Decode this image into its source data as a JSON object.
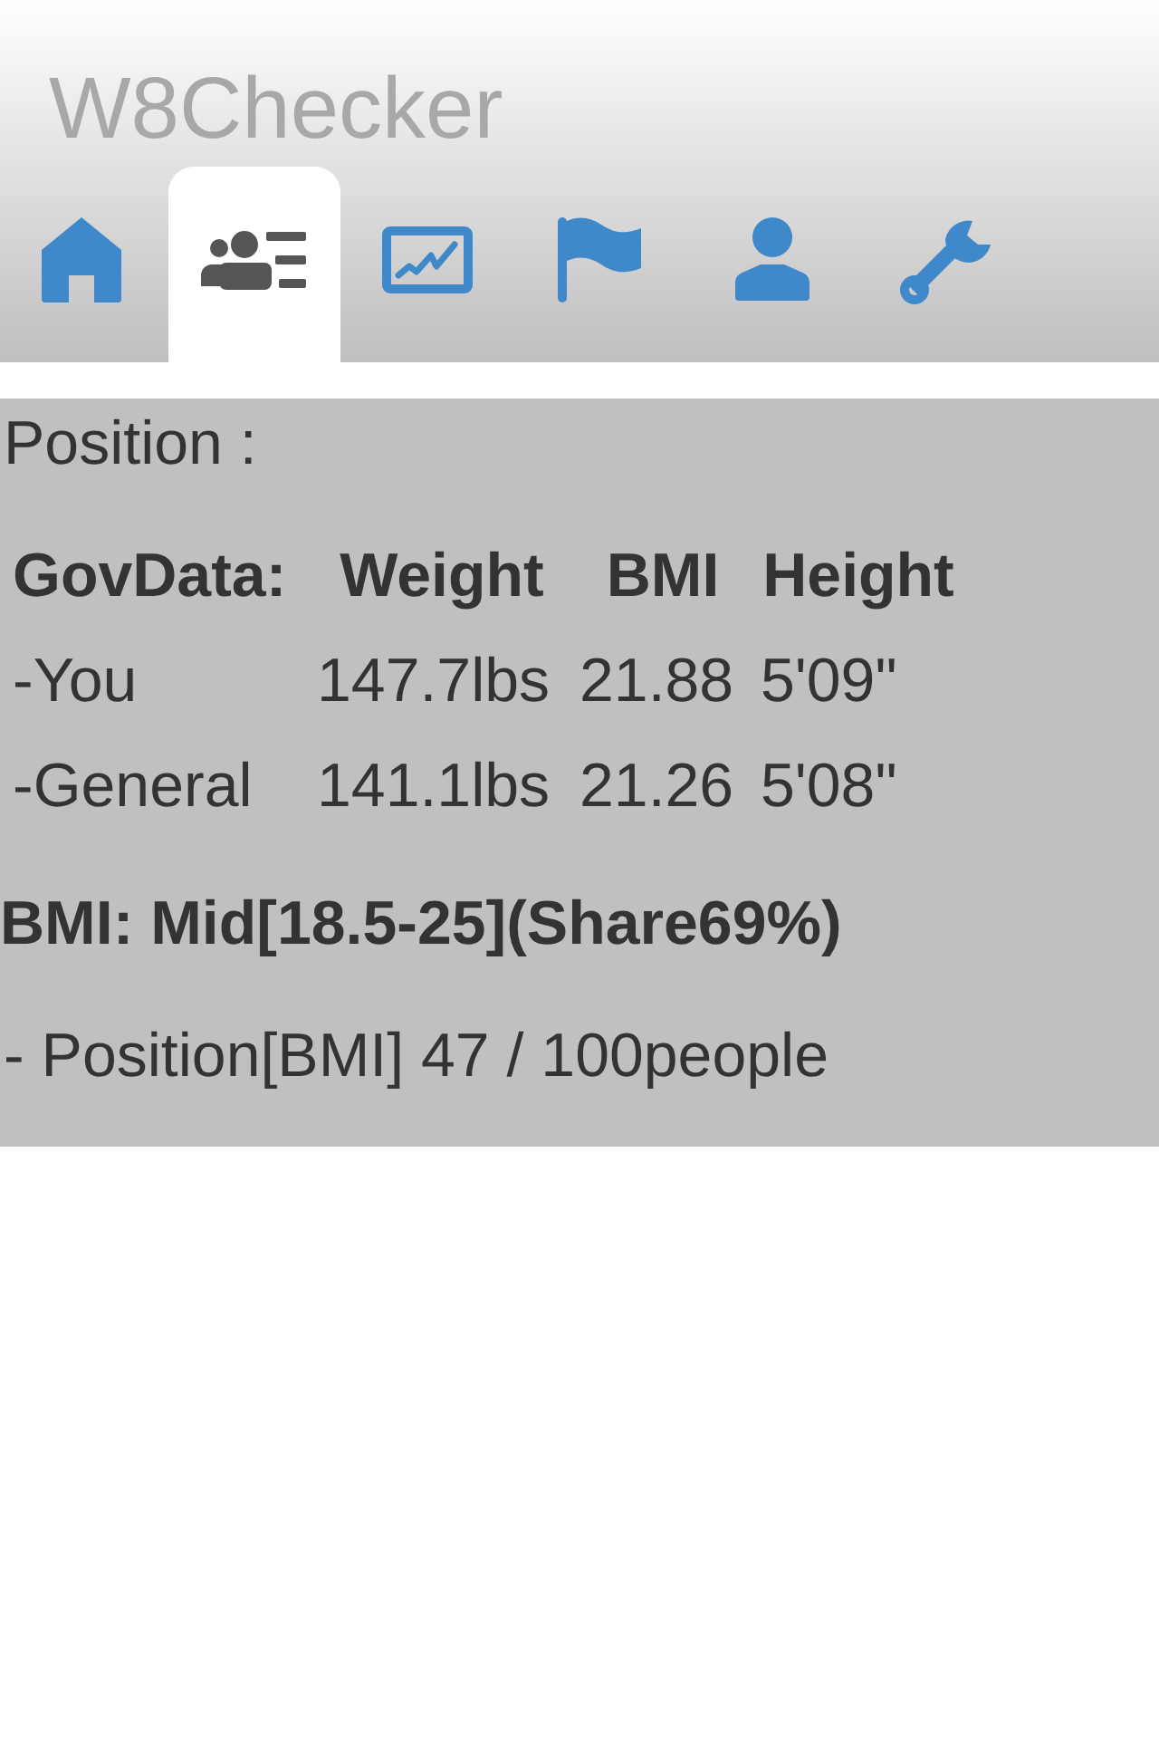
{
  "app": {
    "title": "W8Checker"
  },
  "tabs": [
    {
      "selected": false
    },
    {
      "selected": true
    },
    {
      "selected": false
    },
    {
      "selected": false
    },
    {
      "selected": false
    },
    {
      "selected": false
    }
  ],
  "position": {
    "heading": "Position :",
    "table": {
      "columns": [
        "GovData:",
        "Weight",
        "BMI",
        "Height"
      ],
      "rows": [
        [
          "-You",
          "147.7lbs",
          "21.88",
          "5'09\""
        ],
        [
          "-General",
          "141.1lbs",
          "21.26",
          "5'08\""
        ]
      ]
    },
    "bmi_summary": "BMI: Mid[18.5-25](Share69%)",
    "rank": "- Position[BMI] 47 / 100people"
  }
}
